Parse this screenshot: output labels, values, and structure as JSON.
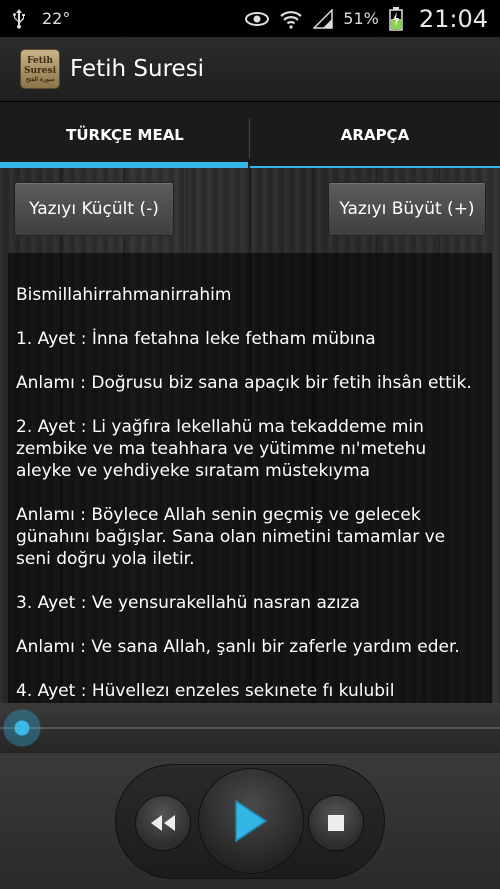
{
  "status_bar": {
    "temperature": "22°",
    "battery_percent": "51%",
    "time": "21:04",
    "icons": [
      "usb-icon",
      "eye-icon",
      "wifi-icon",
      "signal-icon",
      "battery-charging-icon"
    ]
  },
  "app": {
    "title": "Fetih Suresi",
    "logo_text_line1": "Fetih",
    "logo_text_line2": "Suresi",
    "logo_text_line3": "سورة الفتح"
  },
  "tabs": [
    {
      "label": "TÜRKÇE MEAL",
      "active": true
    },
    {
      "label": "ARAPÇA",
      "active": false
    }
  ],
  "buttons": {
    "decrease_font": "Yazıyı Küçült (-)",
    "increase_font": "Yazıyı Büyüt (+)"
  },
  "content": {
    "paragraphs": [
      "Bismillahirrahmanirrahim",
      "1. Ayet : İnna fetahna leke fetham mübına",
      "Anlamı : Doğrusu biz sana apaçık bir fetih ihsân ettik.",
      "2. Ayet : Li yağfıra lekellahü ma tekaddeme min zembike ve ma teahhara ve yütimme nı'metehu aleyke ve yehdiyeke sıratam müstekıyma",
      "Anlamı : Böylece Allah senin geçmiş ve gelecek günahını bağışlar. Sana olan nimetini tamamlar ve seni doğru yola iletir.",
      "3. Ayet : Ve yensurakellahü nasran azıza",
      "Anlamı : Ve sana Allah, şanlı bir zaferle yardım eder.",
      "4. Ayet : Hüvellezı enzeles sekınete fı kulubil"
    ]
  },
  "player": {
    "progress": 0.0,
    "accent_color": "#33b5e5"
  }
}
